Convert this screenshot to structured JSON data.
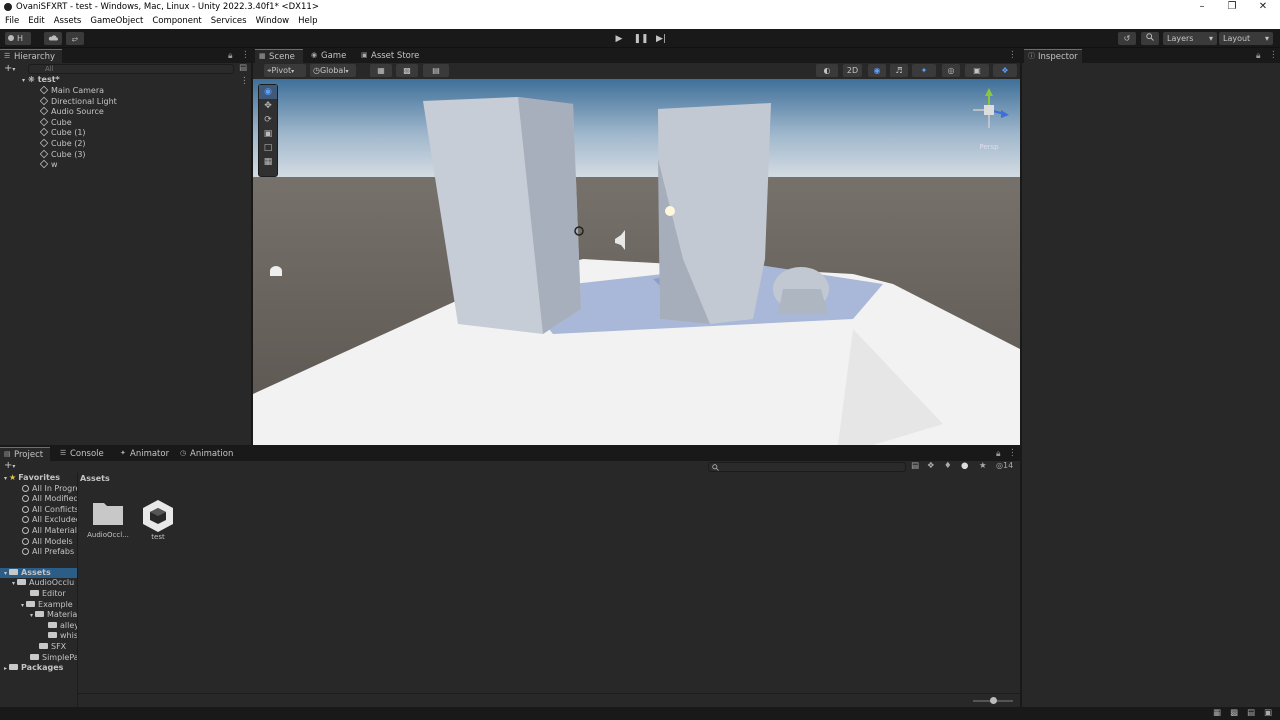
{
  "window": {
    "title": "OvaniSFXRT - test - Windows, Mac, Linux - Unity 2022.3.40f1* <DX11>",
    "controls": [
      "–",
      "❐",
      "✕"
    ]
  },
  "menu": [
    "File",
    "Edit",
    "Assets",
    "GameObject",
    "Component",
    "Services",
    "Window",
    "Help"
  ],
  "toolbar": {
    "account_label": "H",
    "layers_label": "Layers",
    "layout_label": "Layout"
  },
  "hierarchy": {
    "tab_label": "Hierarchy",
    "search_placeholder": "All",
    "scene_name": "test*",
    "items": [
      "Main Camera",
      "Directional Light",
      "Audio Source",
      "Cube",
      "Cube (1)",
      "Cube (2)",
      "Cube (3)",
      "w"
    ]
  },
  "scene_tabs": [
    "Scene",
    "Game",
    "Asset Store"
  ],
  "scene_toolbar": {
    "pivot": "Pivot",
    "global": "Global",
    "mode_2d": "2D"
  },
  "gizmo": {
    "label": "Persp"
  },
  "inspector": {
    "tab_label": "Inspector"
  },
  "bottom_tabs": [
    "Project",
    "Console",
    "Animator",
    "Animation"
  ],
  "project": {
    "hidden_count": "14",
    "favorites_label": "Favorites",
    "favorites": [
      "All In Progre",
      "All Modified",
      "All Conflicts",
      "All Excluded",
      "All Materials",
      "All Models",
      "All Prefabs"
    ],
    "assets_label": "Assets",
    "tree": [
      {
        "label": "AudioOcclu",
        "depth": 1
      },
      {
        "label": "Editor",
        "depth": 2
      },
      {
        "label": "Example",
        "depth": 2
      },
      {
        "label": "Materia",
        "depth": 3
      },
      {
        "label": "alley",
        "depth": 4
      },
      {
        "label": "whis",
        "depth": 4
      },
      {
        "label": "SFX",
        "depth": 2
      },
      {
        "label": "SimplePa",
        "depth": 1
      }
    ],
    "packages_label": "Packages",
    "breadcrumb": "Assets",
    "assets": [
      {
        "name": "AudioOccl...",
        "icon": "folder-icon"
      },
      {
        "name": "test",
        "icon": "unity-scene-icon"
      }
    ]
  },
  "colors": {
    "accent": "#3a79bb",
    "panel": "#282828",
    "background": "#191919",
    "sky": "#c6d3e0",
    "ground": "#5a5550"
  }
}
